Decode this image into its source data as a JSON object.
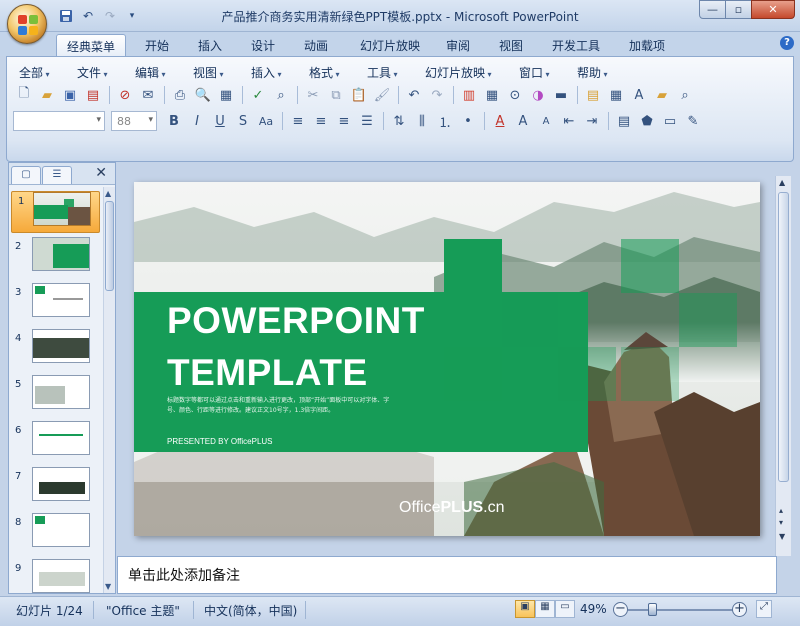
{
  "window": {
    "title": "产品推介商务实用清新绿色PPT模板.pptx - Microsoft PowerPoint",
    "controls": {
      "minimize": "—",
      "restore": "▫",
      "close": "✕"
    }
  },
  "quick_access": {
    "items": [
      "save-icon",
      "undo-icon",
      "redo-icon",
      "customize-icon"
    ]
  },
  "ribbon_tabs": [
    "经典菜单",
    "开始",
    "插入",
    "设计",
    "动画",
    "幻灯片放映",
    "审阅",
    "视图",
    "开发工具",
    "加载项"
  ],
  "active_tab": "经典菜单",
  "classic_menu": [
    "全部",
    "文件",
    "编辑",
    "视图",
    "插入",
    "格式",
    "工具",
    "幻灯片放映",
    "窗口",
    "帮助"
  ],
  "font_controls": {
    "font_name": "",
    "font_size": "88"
  },
  "panel": {
    "tab_outline": "☰",
    "tab_slides": "▢",
    "close": "✕"
  },
  "slides": {
    "numbers": [
      "1",
      "2",
      "3",
      "4",
      "5",
      "6",
      "7",
      "8",
      "9"
    ],
    "selected": "1"
  },
  "slide": {
    "title_line1": "POWERPOINT",
    "title_line2": "TEMPLATE",
    "body_text": "标题数字等都可以通过点击和重新输入进行更改，顶部“开始”面板中可以对字体、字号、颜色、行距等进行修改。建议正文10号字，1.3倍字间距。",
    "presented_by": "PRESENTED BY OfficePLUS",
    "watermark_a": "Office",
    "watermark_b": "PLUS",
    "watermark_c": ".cn",
    "accent_color": "#169c57"
  },
  "notes": {
    "placeholder": "单击此处添加备注"
  },
  "status": {
    "slide_counter": "幻灯片 1/24",
    "theme": "\"Office 主题\"",
    "language": "中文(简体，中国)",
    "zoom": "49%"
  }
}
